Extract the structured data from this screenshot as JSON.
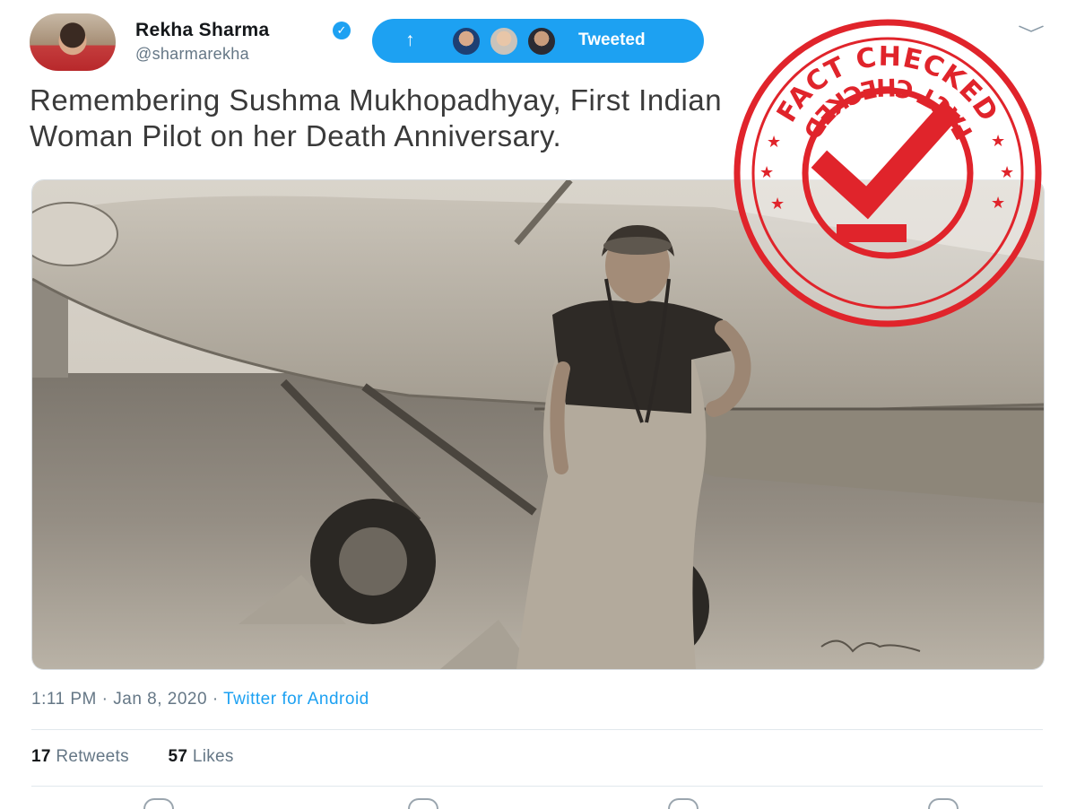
{
  "author": {
    "name": "Rekha Sharma",
    "handle": "@sharmarekha",
    "verified_icon": "✓"
  },
  "tweeted_pill": {
    "arrow": "↑",
    "label": "Tweeted"
  },
  "menu_chevron": "﹀",
  "tweet": {
    "text_line1": "Remembering Sushma Mukhopadhyay, First Indian",
    "text_line2": "Woman Pilot on her Death Anniversary."
  },
  "meta": {
    "time": "1:11 PM",
    "separator": " · ",
    "date": "Jan 8, 2020",
    "source": "Twitter for Android"
  },
  "stats": {
    "retweets_count": "17",
    "retweets_label": "Retweets",
    "likes_count": "57",
    "likes_label": "Likes"
  },
  "stamp": {
    "top_text": "FACT CHECKED",
    "bottom_text": "FACT CHECKED",
    "color": "#e0242b"
  },
  "colors": {
    "accent": "#1da1f2",
    "muted": "#657786"
  }
}
